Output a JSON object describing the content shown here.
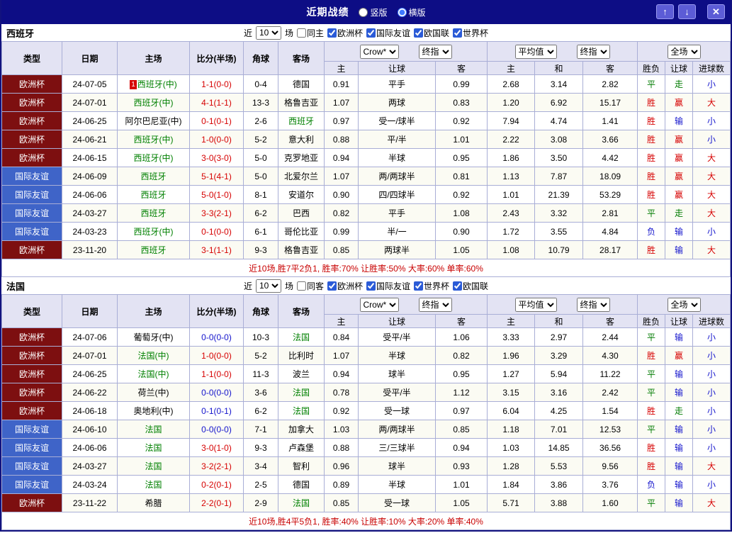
{
  "titlebar": {
    "title": "近期战绩",
    "layout_options": [
      {
        "label": "竖版",
        "checked": false
      },
      {
        "label": "横版",
        "checked": true
      }
    ],
    "up_icon": "↑",
    "down_icon": "↓",
    "close_icon": "✕"
  },
  "colors": {
    "titlebar_bg": "#0d0d85",
    "header_bg": "#e3e3f3",
    "grid_border": "#a9aed6",
    "league": {
      "欧洲杯": "#7d0f10",
      "国际友谊": "#3f64c8"
    },
    "result_text": {
      "胜": "#d60000",
      "赢": "#d60000",
      "大": "#d60000",
      "平": "#007b00",
      "走": "#007b00",
      "负": "#1313cc",
      "输": "#1313cc",
      "小": "#1313cc"
    },
    "score": {
      "red": "#d60000",
      "blue": "#1313cc"
    },
    "featured_team": "#008000",
    "summary_text": "#c80000"
  },
  "table_header": {
    "type": "类型",
    "date": "日期",
    "home": "主场",
    "score": "比分(半场)",
    "corner": "角球",
    "away": "客场",
    "sub": [
      "主",
      "让球",
      "客",
      "主",
      "和",
      "客",
      "胜负",
      "让球",
      "进球数"
    ]
  },
  "sections": [
    {
      "team": "西班牙",
      "filter": {
        "near": "近",
        "games": "10",
        "unit": "场",
        "same_side": {
          "label": "同主",
          "checked": false
        },
        "leagues": [
          {
            "label": "欧洲杯",
            "checked": true
          },
          {
            "label": "国际友谊",
            "checked": true
          },
          {
            "label": "欧国联",
            "checked": true
          },
          {
            "label": "世界杯",
            "checked": true
          }
        ]
      },
      "selects": {
        "asian_1": "Crow*",
        "asian_2": "终指",
        "euro_1": "平均值",
        "euro_2": "终指",
        "result": "全场"
      },
      "rows": [
        {
          "type": "欧洲杯",
          "date": "24-07-05",
          "rank": "1",
          "home": "西班牙(中)",
          "score": "1-1(0-0)",
          "score_color": "red",
          "corner": "0-4",
          "away": "德国",
          "ah_home": "0.91",
          "handicap": "平手",
          "ah_away": "0.99",
          "eu_home": "2.68",
          "eu_draw": "3.14",
          "eu_away": "2.82",
          "res": "平",
          "res_ah": "走",
          "res_ou": "小"
        },
        {
          "type": "欧洲杯",
          "date": "24-07-01",
          "home": "西班牙(中)",
          "score": "4-1(1-1)",
          "score_color": "red",
          "corner": "13-3",
          "away": "格鲁吉亚",
          "ah_home": "1.07",
          "handicap": "两球",
          "ah_away": "0.83",
          "eu_home": "1.20",
          "eu_draw": "6.92",
          "eu_away": "15.17",
          "res": "胜",
          "res_ah": "赢",
          "res_ou": "大"
        },
        {
          "type": "欧洲杯",
          "date": "24-06-25",
          "home": "阿尔巴尼亚(中)",
          "score": "0-1(0-1)",
          "score_color": "red",
          "corner": "2-6",
          "away": "西班牙",
          "ah_home": "0.97",
          "handicap": "受一/球半",
          "ah_away": "0.92",
          "eu_home": "7.94",
          "eu_draw": "4.74",
          "eu_away": "1.41",
          "res": "胜",
          "res_ah": "输",
          "res_ou": "小"
        },
        {
          "type": "欧洲杯",
          "date": "24-06-21",
          "home": "西班牙(中)",
          "score": "1-0(0-0)",
          "score_color": "red",
          "corner": "5-2",
          "away": "意大利",
          "ah_home": "0.88",
          "handicap": "平/半",
          "ah_away": "1.01",
          "eu_home": "2.22",
          "eu_draw": "3.08",
          "eu_away": "3.66",
          "res": "胜",
          "res_ah": "赢",
          "res_ou": "小"
        },
        {
          "type": "欧洲杯",
          "date": "24-06-15",
          "home": "西班牙(中)",
          "score": "3-0(3-0)",
          "score_color": "red",
          "corner": "5-0",
          "away": "克罗地亚",
          "ah_home": "0.94",
          "handicap": "半球",
          "ah_away": "0.95",
          "eu_home": "1.86",
          "eu_draw": "3.50",
          "eu_away": "4.42",
          "res": "胜",
          "res_ah": "赢",
          "res_ou": "大"
        },
        {
          "type": "国际友谊",
          "date": "24-06-09",
          "home": "西班牙",
          "score": "5-1(4-1)",
          "score_color": "red",
          "corner": "5-0",
          "away": "北爱尔兰",
          "ah_home": "1.07",
          "handicap": "两/两球半",
          "ah_away": "0.81",
          "eu_home": "1.13",
          "eu_draw": "7.87",
          "eu_away": "18.09",
          "res": "胜",
          "res_ah": "赢",
          "res_ou": "大"
        },
        {
          "type": "国际友谊",
          "date": "24-06-06",
          "home": "西班牙",
          "score": "5-0(1-0)",
          "score_color": "red",
          "corner": "8-1",
          "away": "安道尔",
          "ah_home": "0.90",
          "handicap": "四/四球半",
          "ah_away": "0.92",
          "eu_home": "1.01",
          "eu_draw": "21.39",
          "eu_away": "53.29",
          "res": "胜",
          "res_ah": "赢",
          "res_ou": "大"
        },
        {
          "type": "国际友谊",
          "date": "24-03-27",
          "home": "西班牙",
          "score": "3-3(2-1)",
          "score_color": "red",
          "corner": "6-2",
          "away": "巴西",
          "ah_home": "0.82",
          "handicap": "平手",
          "ah_away": "1.08",
          "eu_home": "2.43",
          "eu_draw": "3.32",
          "eu_away": "2.81",
          "res": "平",
          "res_ah": "走",
          "res_ou": "大"
        },
        {
          "type": "国际友谊",
          "date": "24-03-23",
          "home": "西班牙(中)",
          "score": "0-1(0-0)",
          "score_color": "red",
          "corner": "6-1",
          "away": "哥伦比亚",
          "ah_home": "0.99",
          "handicap": "半/一",
          "ah_away": "0.90",
          "eu_home": "1.72",
          "eu_draw": "3.55",
          "eu_away": "4.84",
          "res": "负",
          "res_ah": "输",
          "res_ou": "小"
        },
        {
          "type": "欧洲杯",
          "date": "23-11-20",
          "home": "西班牙",
          "score": "3-1(1-1)",
          "score_color": "red",
          "corner": "9-3",
          "away": "格鲁吉亚",
          "ah_home": "0.85",
          "handicap": "两球半",
          "ah_away": "1.05",
          "eu_home": "1.08",
          "eu_draw": "10.79",
          "eu_away": "28.17",
          "res": "胜",
          "res_ah": "输",
          "res_ou": "大"
        }
      ],
      "summary": "近10场,胜7平2负1, 胜率:70% 让胜率:50% 大率:60% 单率:60%"
    },
    {
      "team": "法国",
      "filter": {
        "near": "近",
        "games": "10",
        "unit": "场",
        "same_side": {
          "label": "同客",
          "checked": false
        },
        "leagues": [
          {
            "label": "欧洲杯",
            "checked": true
          },
          {
            "label": "国际友谊",
            "checked": true
          },
          {
            "label": "世界杯",
            "checked": true
          },
          {
            "label": "欧国联",
            "checked": true
          }
        ]
      },
      "selects": {
        "asian_1": "Crow*",
        "asian_2": "终指",
        "euro_1": "平均值",
        "euro_2": "终指",
        "result": "全场"
      },
      "rows": [
        {
          "type": "欧洲杯",
          "date": "24-07-06",
          "home": "葡萄牙(中)",
          "score": "0-0(0-0)",
          "score_color": "blue",
          "corner": "10-3",
          "away": "法国",
          "ah_home": "0.84",
          "handicap": "受平/半",
          "ah_away": "1.06",
          "eu_home": "3.33",
          "eu_draw": "2.97",
          "eu_away": "2.44",
          "res": "平",
          "res_ah": "输",
          "res_ou": "小"
        },
        {
          "type": "欧洲杯",
          "date": "24-07-01",
          "home": "法国(中)",
          "score": "1-0(0-0)",
          "score_color": "red",
          "corner": "5-2",
          "away": "比利时",
          "ah_home": "1.07",
          "handicap": "半球",
          "ah_away": "0.82",
          "eu_home": "1.96",
          "eu_draw": "3.29",
          "eu_away": "4.30",
          "res": "胜",
          "res_ah": "赢",
          "res_ou": "小"
        },
        {
          "type": "欧洲杯",
          "date": "24-06-25",
          "home": "法国(中)",
          "score": "1-1(0-0)",
          "score_color": "red",
          "corner": "11-3",
          "away": "波兰",
          "ah_home": "0.94",
          "handicap": "球半",
          "ah_away": "0.95",
          "eu_home": "1.27",
          "eu_draw": "5.94",
          "eu_away": "11.22",
          "res": "平",
          "res_ah": "输",
          "res_ou": "小"
        },
        {
          "type": "欧洲杯",
          "date": "24-06-22",
          "home": "荷兰(中)",
          "score": "0-0(0-0)",
          "score_color": "blue",
          "corner": "3-6",
          "away": "法国",
          "ah_home": "0.78",
          "handicap": "受平/半",
          "ah_away": "1.12",
          "eu_home": "3.15",
          "eu_draw": "3.16",
          "eu_away": "2.42",
          "res": "平",
          "res_ah": "输",
          "res_ou": "小"
        },
        {
          "type": "欧洲杯",
          "date": "24-06-18",
          "home": "奥地利(中)",
          "score": "0-1(0-1)",
          "score_color": "blue",
          "corner": "6-2",
          "away": "法国",
          "ah_home": "0.92",
          "handicap": "受一球",
          "ah_away": "0.97",
          "eu_home": "6.04",
          "eu_draw": "4.25",
          "eu_away": "1.54",
          "res": "胜",
          "res_ah": "走",
          "res_ou": "小"
        },
        {
          "type": "国际友谊",
          "date": "24-06-10",
          "home": "法国",
          "score": "0-0(0-0)",
          "score_color": "blue",
          "corner": "7-1",
          "away": "加拿大",
          "ah_home": "1.03",
          "handicap": "两/两球半",
          "ah_away": "0.85",
          "eu_home": "1.18",
          "eu_draw": "7.01",
          "eu_away": "12.53",
          "res": "平",
          "res_ah": "输",
          "res_ou": "小"
        },
        {
          "type": "国际友谊",
          "date": "24-06-06",
          "home": "法国",
          "score": "3-0(1-0)",
          "score_color": "red",
          "corner": "9-3",
          "away": "卢森堡",
          "ah_home": "0.88",
          "handicap": "三/三球半",
          "ah_away": "0.94",
          "eu_home": "1.03",
          "eu_draw": "14.85",
          "eu_away": "36.56",
          "res": "胜",
          "res_ah": "输",
          "res_ou": "小"
        },
        {
          "type": "国际友谊",
          "date": "24-03-27",
          "home": "法国",
          "score": "3-2(2-1)",
          "score_color": "red",
          "corner": "3-4",
          "away": "智利",
          "ah_home": "0.96",
          "handicap": "球半",
          "ah_away": "0.93",
          "eu_home": "1.28",
          "eu_draw": "5.53",
          "eu_away": "9.56",
          "res": "胜",
          "res_ah": "输",
          "res_ou": "大"
        },
        {
          "type": "国际友谊",
          "date": "24-03-24",
          "home": "法国",
          "score": "0-2(0-1)",
          "score_color": "red",
          "corner": "2-5",
          "away": "德国",
          "ah_home": "0.89",
          "handicap": "半球",
          "ah_away": "1.01",
          "eu_home": "1.84",
          "eu_draw": "3.86",
          "eu_away": "3.76",
          "res": "负",
          "res_ah": "输",
          "res_ou": "小"
        },
        {
          "type": "欧洲杯",
          "date": "23-11-22",
          "home": "希腊",
          "score": "2-2(0-1)",
          "score_color": "red",
          "corner": "2-9",
          "away": "法国",
          "ah_home": "0.85",
          "handicap": "受一球",
          "ah_away": "1.05",
          "eu_home": "5.71",
          "eu_draw": "3.88",
          "eu_away": "1.60",
          "res": "平",
          "res_ah": "输",
          "res_ou": "大"
        }
      ],
      "summary": "近10场,胜4平5负1, 胜率:40% 让胜率:10% 大率:20% 单率:40%"
    }
  ]
}
